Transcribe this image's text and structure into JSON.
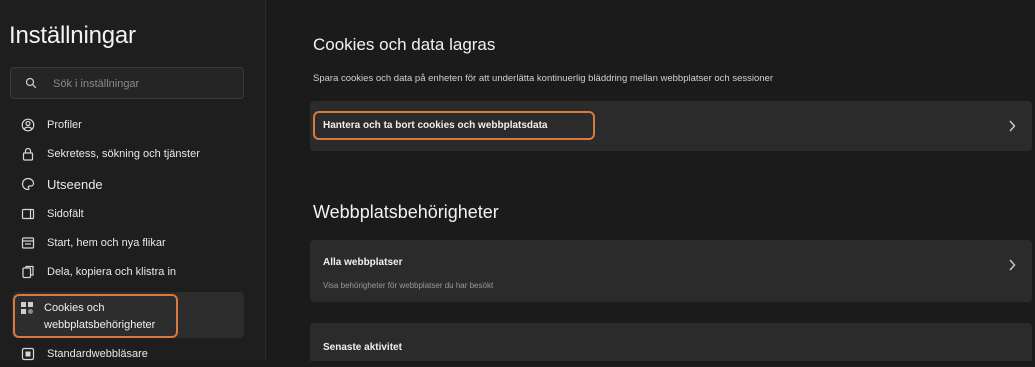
{
  "sidebar": {
    "title": "Inställningar",
    "search_placeholder": "Sök i inställningar",
    "items": [
      {
        "label": "Profiler",
        "icon": "profile-icon"
      },
      {
        "label": "Sekretess, sökning och tjänster",
        "icon": "lock-icon"
      },
      {
        "label": "Utseende",
        "icon": "appearance-icon"
      },
      {
        "label": "Sidofält",
        "icon": "sidebar-icon"
      },
      {
        "label": "Start, hem och nya flikar",
        "icon": "home-tabs-icon"
      },
      {
        "label": "Dela, kopiera och klistra in",
        "icon": "share-icon"
      },
      {
        "label": "Cookies och webbplatsbehörigheter",
        "icon": "cookies-icon"
      },
      {
        "label": "Standardwebbläsare",
        "icon": "browser-icon"
      }
    ]
  },
  "main": {
    "cookies_title": "Cookies och data lagras",
    "cookies_desc": "Spara cookies och data på enheten för att underlätta kontinuerlig bläddring mellan webbplatser och sessioner",
    "manage_label": "Hantera och ta bort cookies och webbplatsdata",
    "perms_title": "Webbplatsbehörigheter",
    "all_sites_label": "Alla webbplatser",
    "all_sites_sub": "Visa behörigheter för webbplatser du har besökt",
    "recent_label": "Senaste aktivitet"
  },
  "colors": {
    "accent_outline": "#d77a3a",
    "background": "#1b1b1b",
    "card": "#2b2b2b"
  }
}
